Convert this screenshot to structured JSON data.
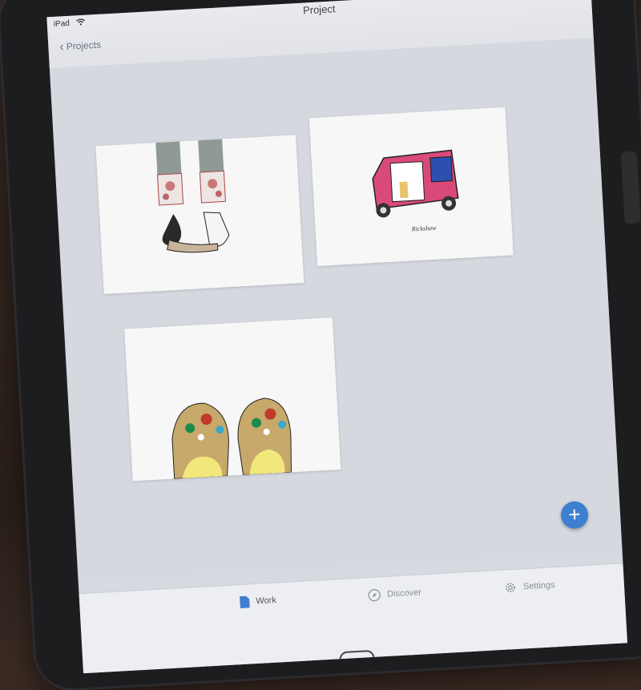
{
  "status_bar": {
    "device": "iPad"
  },
  "nav": {
    "title": "Project",
    "back_label": "Projects"
  },
  "gallery": {
    "items": [
      {
        "subject": "feet in embroidered trousers and sandals"
      },
      {
        "subject": "rickshaw illustration",
        "caption": "Rickshaw"
      },
      {
        "subject": "jeweled slippers"
      }
    ]
  },
  "fab": {
    "label": "+"
  },
  "tabs": [
    {
      "label": "Work",
      "icon": "document-icon",
      "active": true
    },
    {
      "label": "Discover",
      "icon": "compass-icon",
      "active": false
    },
    {
      "label": "Settings",
      "icon": "gear-icon",
      "active": false
    }
  ],
  "colors": {
    "accent": "#3f7fcf",
    "screen_bg": "#d5d8df",
    "nav_bg": "#e6e8ec"
  }
}
